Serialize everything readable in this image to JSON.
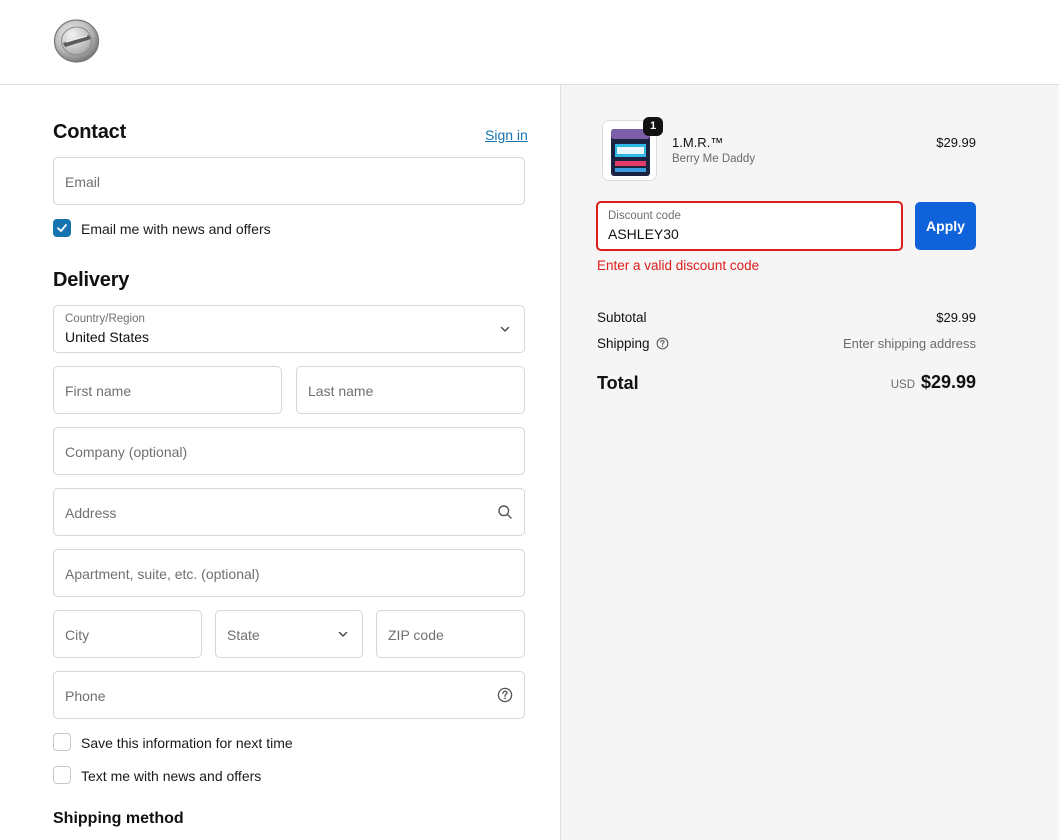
{
  "header": {
    "logo_icon": "brand-logo-icon"
  },
  "contact": {
    "title": "Contact",
    "sign_in": "Sign in",
    "email_placeholder": "Email",
    "newsletter_label": "Email me with news and offers",
    "newsletter_checked": true
  },
  "delivery": {
    "title": "Delivery",
    "country_label": "Country/Region",
    "country_value": "United States",
    "first_name": "First name",
    "last_name": "Last name",
    "company": "Company (optional)",
    "address": "Address",
    "apartment": "Apartment, suite, etc. (optional)",
    "city": "City",
    "state": "State",
    "zip": "ZIP code",
    "phone": "Phone",
    "save_info_label": "Save this information for next time",
    "text_me_label": "Text me with news and offers"
  },
  "shipping_method": {
    "title": "Shipping method"
  },
  "cart": {
    "quantity": "1",
    "product_name": "1.M.R.™",
    "product_variant": "Berry Me Daddy",
    "product_price": "$29.99"
  },
  "discount": {
    "label": "Discount code",
    "value": "ASHLEY30",
    "apply": "Apply",
    "error": "Enter a valid discount code"
  },
  "summary": {
    "subtotal_label": "Subtotal",
    "subtotal_value": "$29.99",
    "shipping_label": "Shipping",
    "shipping_value": "Enter shipping address",
    "total_label": "Total",
    "currency": "USD",
    "total_value": "$29.99"
  },
  "colors": {
    "accent": "#1773b0",
    "apply_button": "#0f62d9",
    "error": "#dd1d1d",
    "summary_bg": "#f5f5f5"
  }
}
